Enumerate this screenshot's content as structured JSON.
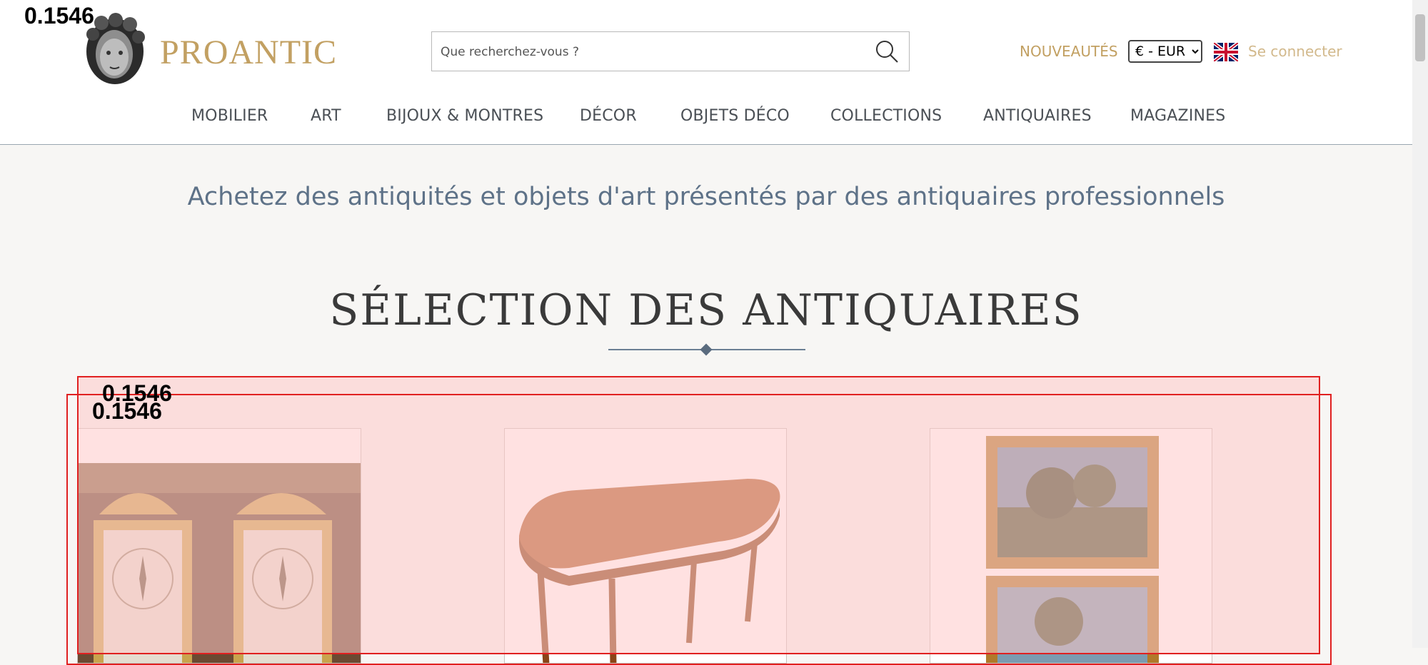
{
  "overlay_scores": [
    "0.1546",
    "0.1546",
    "0.1546"
  ],
  "brand": {
    "name": "PROANTIC",
    "color": "#c2a062"
  },
  "search": {
    "placeholder": "Que recherchez-vous ?",
    "icon": "search-icon"
  },
  "header_links": {
    "new_label": "NOUVEAUTÉS",
    "login_label": "Se connecter",
    "language_icon": "uk-flag-icon"
  },
  "currency": {
    "selected": "€ - EUR"
  },
  "nav": {
    "items": [
      {
        "label": "MOBILIER"
      },
      {
        "label": "ART"
      },
      {
        "label": "BIJOUX & MONTRES"
      },
      {
        "label": "DÉCOR"
      },
      {
        "label": "OBJETS DÉCO"
      },
      {
        "label": "COLLECTIONS"
      },
      {
        "label": "ANTIQUAIRES"
      },
      {
        "label": "MAGAZINES"
      }
    ]
  },
  "tagline": "Achetez des antiquités et objets d'art présentés par des antiquaires professionnels",
  "section": {
    "title": "SÉLECTION DES ANTIQUAIRES"
  },
  "products": [
    {
      "image": "pair-of-gilded-framed-barometers"
    },
    {
      "image": "oval-wooden-extending-table"
    },
    {
      "image": "pair-of-framed-landscape-paintings"
    }
  ],
  "colors": {
    "accent": "#c2a062",
    "text_blue": "#5e7288",
    "background": "#f7f6f4",
    "overlay_border": "#e02020"
  }
}
